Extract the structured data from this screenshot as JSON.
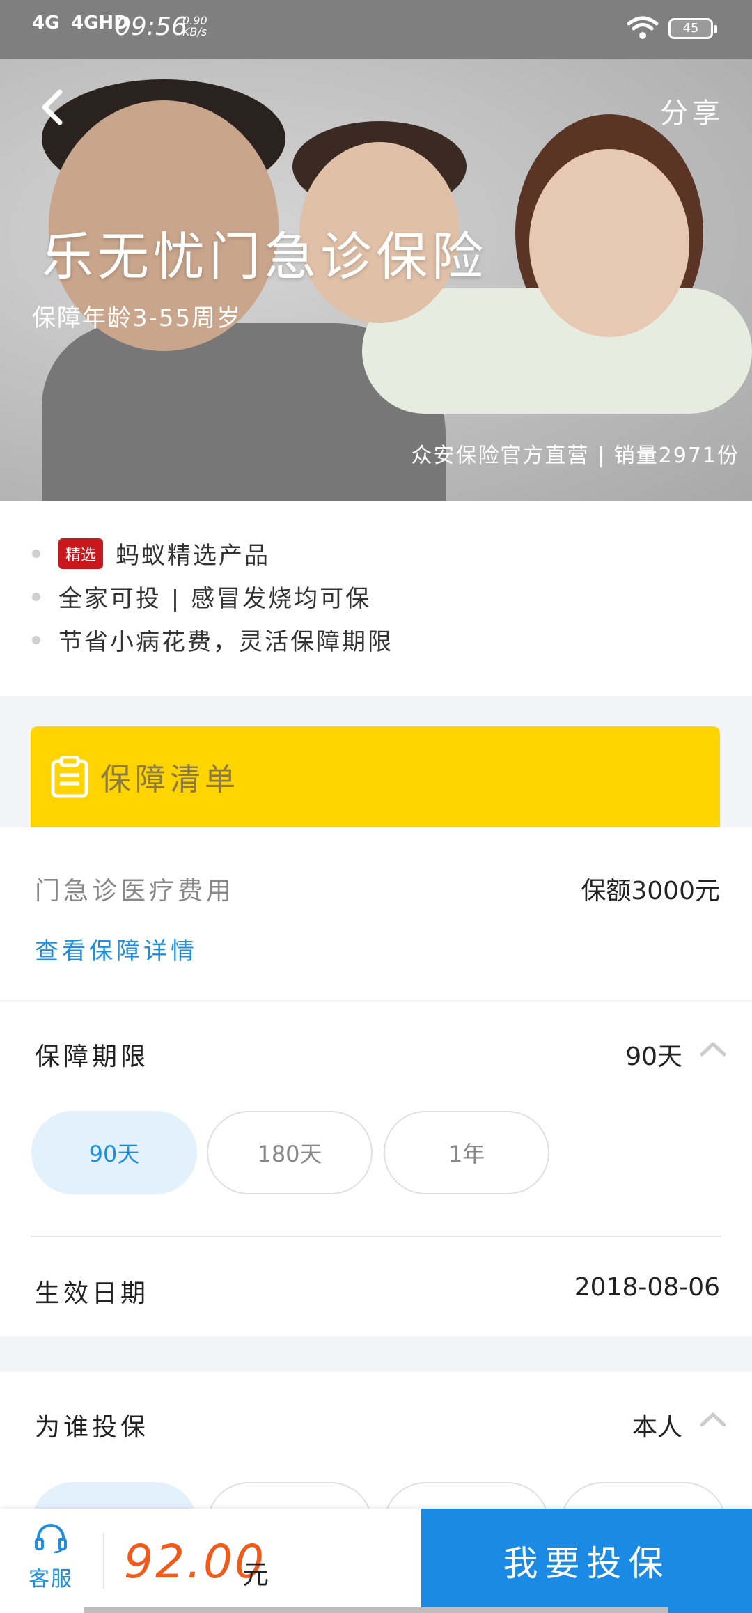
{
  "status_bar": {
    "signal1": "4G",
    "signal2": "4GHD",
    "time": "09:56",
    "net_speed_value": "0.90",
    "net_speed_unit": "KB/s",
    "battery": "45"
  },
  "hero": {
    "title": "乐无忧门急诊保险",
    "subtitle": "保障年龄3-55周岁",
    "share_label": "分享",
    "tagline": "众安保险官方直营 | 销量2971份"
  },
  "features": {
    "badge": "精选",
    "items": [
      "蚂蚁精选产品",
      "全家可投 | 感冒发烧均可保",
      "节省小病花费，灵活保障期限"
    ]
  },
  "coverage": {
    "banner_title": "保障清单",
    "item_label": "门急诊医疗费用",
    "item_value": "保额3000元",
    "detail_link": "查看保障详情"
  },
  "period": {
    "label": "保障期限",
    "selected_value": "90天",
    "options": [
      "90天",
      "180天",
      "1年"
    ]
  },
  "effective": {
    "label": "生效日期",
    "value": "2018-08-06"
  },
  "insured": {
    "label": "为谁投保",
    "selected_value": "本人"
  },
  "bottom_bar": {
    "service_label": "客服",
    "price": "92.00",
    "unit": "元",
    "buy_label": "我要投保"
  },
  "colors": {
    "accent_blue": "#1a8ae5",
    "banner_yellow": "#ffd400",
    "price_orange": "#f05a1a",
    "badge_red": "#c9171e"
  }
}
